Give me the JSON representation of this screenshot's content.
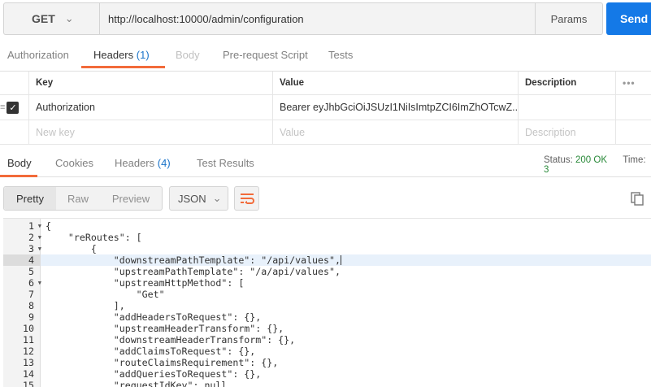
{
  "request": {
    "method": "GET",
    "url": "http://localhost:10000/admin/configuration",
    "params_label": "Params",
    "send_label": "Send"
  },
  "request_tabs": {
    "authorization": "Authorization",
    "headers": "Headers",
    "headers_count": "(1)",
    "body": "Body",
    "prerequest": "Pre-request Script",
    "tests": "Tests"
  },
  "headers_table": {
    "col_key": "Key",
    "col_value": "Value",
    "col_description": "Description",
    "more": "•••",
    "rows": [
      {
        "key": "Authorization",
        "value": "Bearer eyJhbGciOiJSUzI1NiIsImtpZCI6ImZhOTcwZ..."
      }
    ],
    "new_key_placeholder": "New key",
    "value_placeholder": "Value",
    "description_placeholder": "Description"
  },
  "response_tabs": {
    "body": "Body",
    "cookies": "Cookies",
    "headers": "Headers",
    "headers_count": "(4)",
    "test_results": "Test Results"
  },
  "status": {
    "status_label": "Status:",
    "status_value": "200 OK",
    "time_label": "Time:",
    "time_value": "3"
  },
  "response_toolbar": {
    "pretty": "Pretty",
    "raw": "Raw",
    "preview": "Preview",
    "format": "JSON"
  },
  "editor": {
    "active_line": 4,
    "lines": [
      "{",
      "    \"reRoutes\": [",
      "        {",
      "            \"downstreamPathTemplate\": \"/api/values\",",
      "            \"upstreamPathTemplate\": \"/a/api/values\",",
      "            \"upstreamHttpMethod\": [",
      "                \"Get\"",
      "            ],",
      "            \"addHeadersToRequest\": {},",
      "            \"upstreamHeaderTransform\": {},",
      "            \"downstreamHeaderTransform\": {},",
      "            \"addClaimsToRequest\": {},",
      "            \"routeClaimsRequirement\": {},",
      "            \"addQueriesToRequest\": {},",
      "            \"requestIdKey\": null,"
    ],
    "fold_lines": [
      1,
      2,
      3,
      6
    ]
  },
  "icons": {
    "method_dropdown": "chevron-down-icon",
    "format_dropdown": "chevron-down-icon",
    "wrap": "wrap-lines-icon",
    "copy": "copy-icon",
    "checkbox": "checkmark-icon",
    "drag": "drag-handle-icon"
  },
  "colors": {
    "send": "#1479e7",
    "tab_accent": "#f26b3a",
    "count": "#1a73c9",
    "status_ok": "#2a8a3a"
  }
}
